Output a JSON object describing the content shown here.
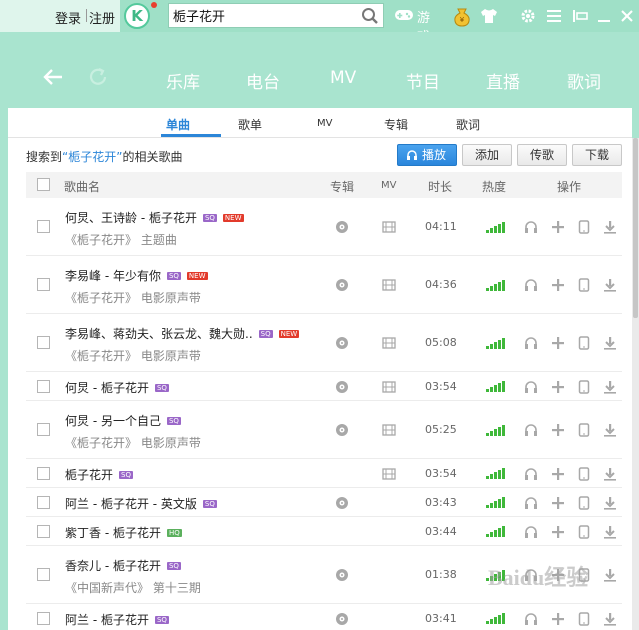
{
  "header": {
    "login": "登录",
    "register": "注册",
    "logo_letter": "K",
    "search_value": "栀子花开",
    "game_label": "游戏"
  },
  "nav": {
    "items": [
      "乐库",
      "电台",
      "MV",
      "节目",
      "直播",
      "歌词"
    ]
  },
  "tabs": [
    "单曲",
    "歌单",
    "MV",
    "专辑",
    "歌词"
  ],
  "active_tab": "单曲",
  "result": {
    "prefix": "搜索到",
    "keyword": "“栀子花开”",
    "suffix": "的相关歌曲"
  },
  "buttons": {
    "play": "播放",
    "add": "添加",
    "share": "传歌",
    "download": "下载"
  },
  "columns": {
    "name": "歌曲名",
    "album": "专辑",
    "mv": "MV",
    "duration": "时长",
    "heat": "热度",
    "ops": "操作"
  },
  "songs": [
    {
      "title": "何炅、王诗龄 - 栀子花开",
      "sub": "《栀子花开》 主题曲",
      "badges": [
        "SQ",
        "NEW"
      ],
      "album": true,
      "mv": true,
      "duration": "04:11"
    },
    {
      "title": "李易峰 - 年少有你",
      "sub": "《栀子花开》 电影原声带",
      "badges": [
        "SQ",
        "NEW"
      ],
      "album": true,
      "mv": true,
      "duration": "04:36"
    },
    {
      "title": "李易峰、蒋劲夫、张云龙、魏大勋..",
      "sub": "《栀子花开》 电影原声带",
      "badges": [
        "SQ",
        "NEW"
      ],
      "album": true,
      "mv": true,
      "duration": "05:08"
    },
    {
      "title": "何炅 - 栀子花开",
      "sub": "",
      "badges": [
        "SQ"
      ],
      "album": true,
      "mv": true,
      "duration": "03:54"
    },
    {
      "title": "何炅 - 另一个自己",
      "sub": "《栀子花开》 电影原声带",
      "badges": [
        "SQ"
      ],
      "album": true,
      "mv": true,
      "duration": "05:25"
    },
    {
      "title": "栀子花开",
      "sub": "",
      "badges": [
        "SQ"
      ],
      "album": false,
      "mv": true,
      "duration": "03:54"
    },
    {
      "title": "阿兰 - 栀子花开 - 英文版",
      "sub": "",
      "badges": [
        "SQ"
      ],
      "album": true,
      "mv": false,
      "duration": "03:43"
    },
    {
      "title": "紫丁香 - 栀子花开",
      "sub": "",
      "badges": [
        "HQ"
      ],
      "album": false,
      "mv": false,
      "duration": "03:44"
    },
    {
      "title": "香奈儿 - 栀子花开",
      "sub": "《中国新声代》 第十三期",
      "badges": [
        "SQ"
      ],
      "album": true,
      "mv": false,
      "duration": "01:38"
    },
    {
      "title": "阿兰 - 栀子花开",
      "sub": "",
      "badges": [
        "SQ"
      ],
      "album": true,
      "mv": false,
      "duration": "03:41"
    }
  ],
  "watermark": "Baidu经验",
  "colors": {
    "accent": "#2c86d8",
    "header": "#a9e4cf",
    "heat": "#3fb83a"
  }
}
